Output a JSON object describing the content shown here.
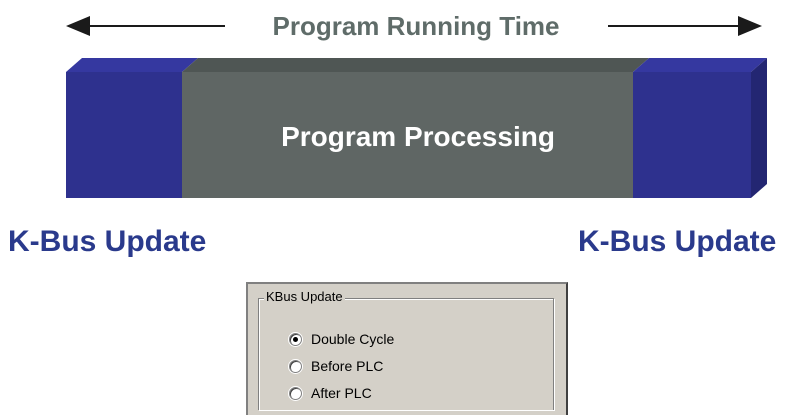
{
  "header": {
    "title": "Program Running Time"
  },
  "bar": {
    "processing_label": "Program Processing",
    "colors": {
      "kbus_block": "#2e318e",
      "kbus_block_side": "#232672",
      "processing_block": "#5f6664",
      "processing_top": "#4f5654",
      "kbus_top": "#3538a0"
    }
  },
  "labels": {
    "kbus_left": "K-Bus Update",
    "kbus_right": "K-Bus Update",
    "kbus_color": "#2a3a8c"
  },
  "settings_panel": {
    "legend": "KBus Update",
    "options": [
      {
        "label": "Double Cycle",
        "selected": true
      },
      {
        "label": "Before PLC",
        "selected": false
      },
      {
        "label": "After PLC",
        "selected": false
      }
    ]
  }
}
